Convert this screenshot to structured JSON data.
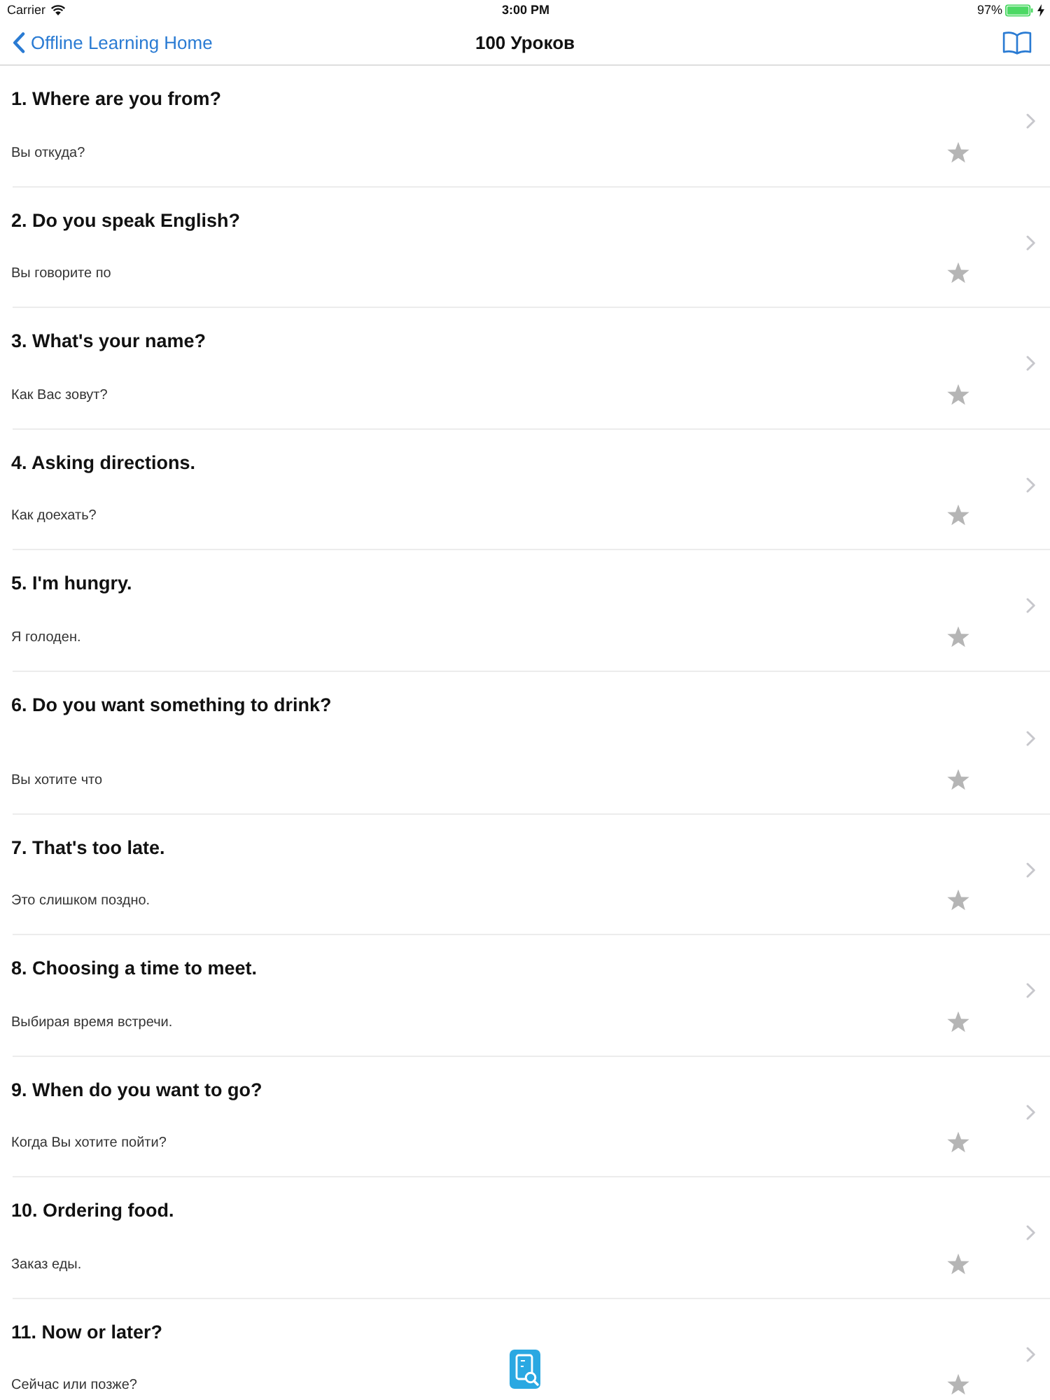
{
  "status_bar": {
    "carrier": "Carrier",
    "time": "3:00 PM",
    "battery": "97%",
    "charging": true
  },
  "nav_bar": {
    "back": "Offline Learning Home",
    "title": "100 Уроков"
  },
  "lessons": [
    {
      "title": "1. Where are you from?",
      "subtitle": "Вы откуда?",
      "favorite": false
    },
    {
      "title": "2. Do you speak English?",
      "subtitle": "Вы говорите по",
      "favorite": false
    },
    {
      "title": "3. What's your name?",
      "subtitle": "Как Вас зовут?",
      "favorite": false
    },
    {
      "title": "4. Asking directions.",
      "subtitle": "Как доехать?",
      "favorite": false
    },
    {
      "title": "5. I'm hungry.",
      "subtitle": "Я голоден.",
      "favorite": false
    },
    {
      "title": "6. Do you want something to drink?",
      "subtitle": "Вы хотите что",
      "favorite": false
    },
    {
      "title": "7. That's too late.",
      "subtitle": "Это слишком поздно.",
      "favorite": false
    },
    {
      "title": "8. Choosing a time to meet.",
      "subtitle": "Выбирая время встречи.",
      "favorite": false
    },
    {
      "title": "9. When do you want to go?",
      "subtitle": "Когда Вы хотите пойти?",
      "favorite": false
    },
    {
      "title": "10. Ordering food.",
      "subtitle": "Заказ еды.",
      "favorite": false
    },
    {
      "title": "11. Now or later?",
      "subtitle": "Сейчас или позже?",
      "favorite": false
    }
  ]
}
